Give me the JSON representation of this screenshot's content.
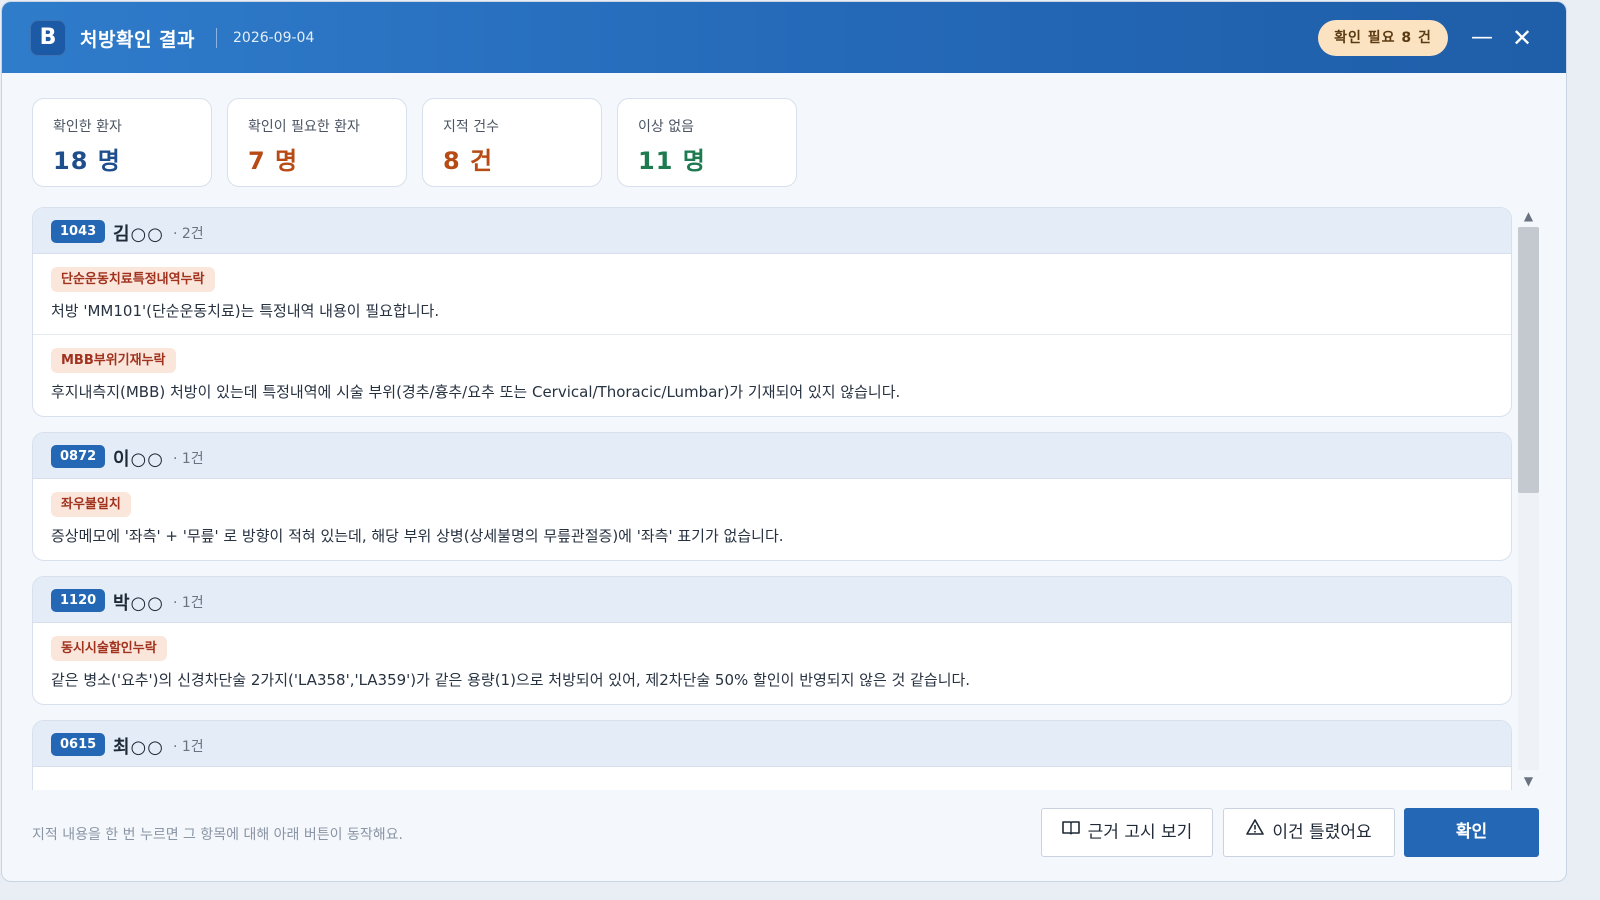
{
  "window": {
    "logo_letter": "B",
    "title": "처방확인 결과",
    "date": "2026-09-04",
    "need_badge": "확인 필요 8 건",
    "minimize": "—",
    "close": "✕"
  },
  "stats": [
    {
      "label": "확인한 환자",
      "value": "18 명",
      "color": "#1f4e8c"
    },
    {
      "label": "확인이 필요한 환자",
      "value": "7 명",
      "color": "#b84a14"
    },
    {
      "label": "지적 건수",
      "value": "8 건",
      "color": "#b84a14"
    },
    {
      "label": "이상 없음",
      "value": "11 명",
      "color": "#1e7a4f"
    }
  ],
  "patients": [
    {
      "id": "1043",
      "name": "김○○",
      "count": "· 2건",
      "findings": [
        {
          "tag": "단순운동치료특정내역누락",
          "text": "처방 'MM101'(단순운동치료)는 특정내역 내용이 필요합니다."
        },
        {
          "tag": "MBB부위기재누락",
          "text": "후지내측지(MBB) 처방이 있는데 특정내역에 시술 부위(경추/흉추/요추 또는 Cervical/Thoracic/Lumbar)가 기재되어 있지 않습니다."
        }
      ]
    },
    {
      "id": "0872",
      "name": "이○○",
      "count": "· 1건",
      "findings": [
        {
          "tag": "좌우불일치",
          "text": "증상메모에 '좌측' + '무릎' 로 방향이 적혀 있는데, 해당 부위 상병(상세불명의 무릎관절증)에 '좌측' 표기가 없습니다."
        }
      ]
    },
    {
      "id": "1120",
      "name": "박○○",
      "count": "· 1건",
      "findings": [
        {
          "tag": "동시시술할인누락",
          "text": "같은 병소('요추')의 신경차단술 2가지('LA358','LA359')가 같은 용량(1)으로 처방되어 있어, 제2차단술 50% 할인이 반영되지 않은 것 같습니다."
        }
      ]
    },
    {
      "id": "0615",
      "name": "최○○",
      "count": "· 1건",
      "findings": []
    }
  ],
  "scroll": {
    "position": 0.0,
    "visible_fraction": 0.49
  },
  "footer": {
    "hint": "지적 내용을 한 번 누르면 그 항목에 대해 아래 버튼이 동작해요.",
    "basis_button": "근거 고시 보기",
    "wrong_button": "이건 틀렸어요",
    "ok_button": "확인"
  }
}
